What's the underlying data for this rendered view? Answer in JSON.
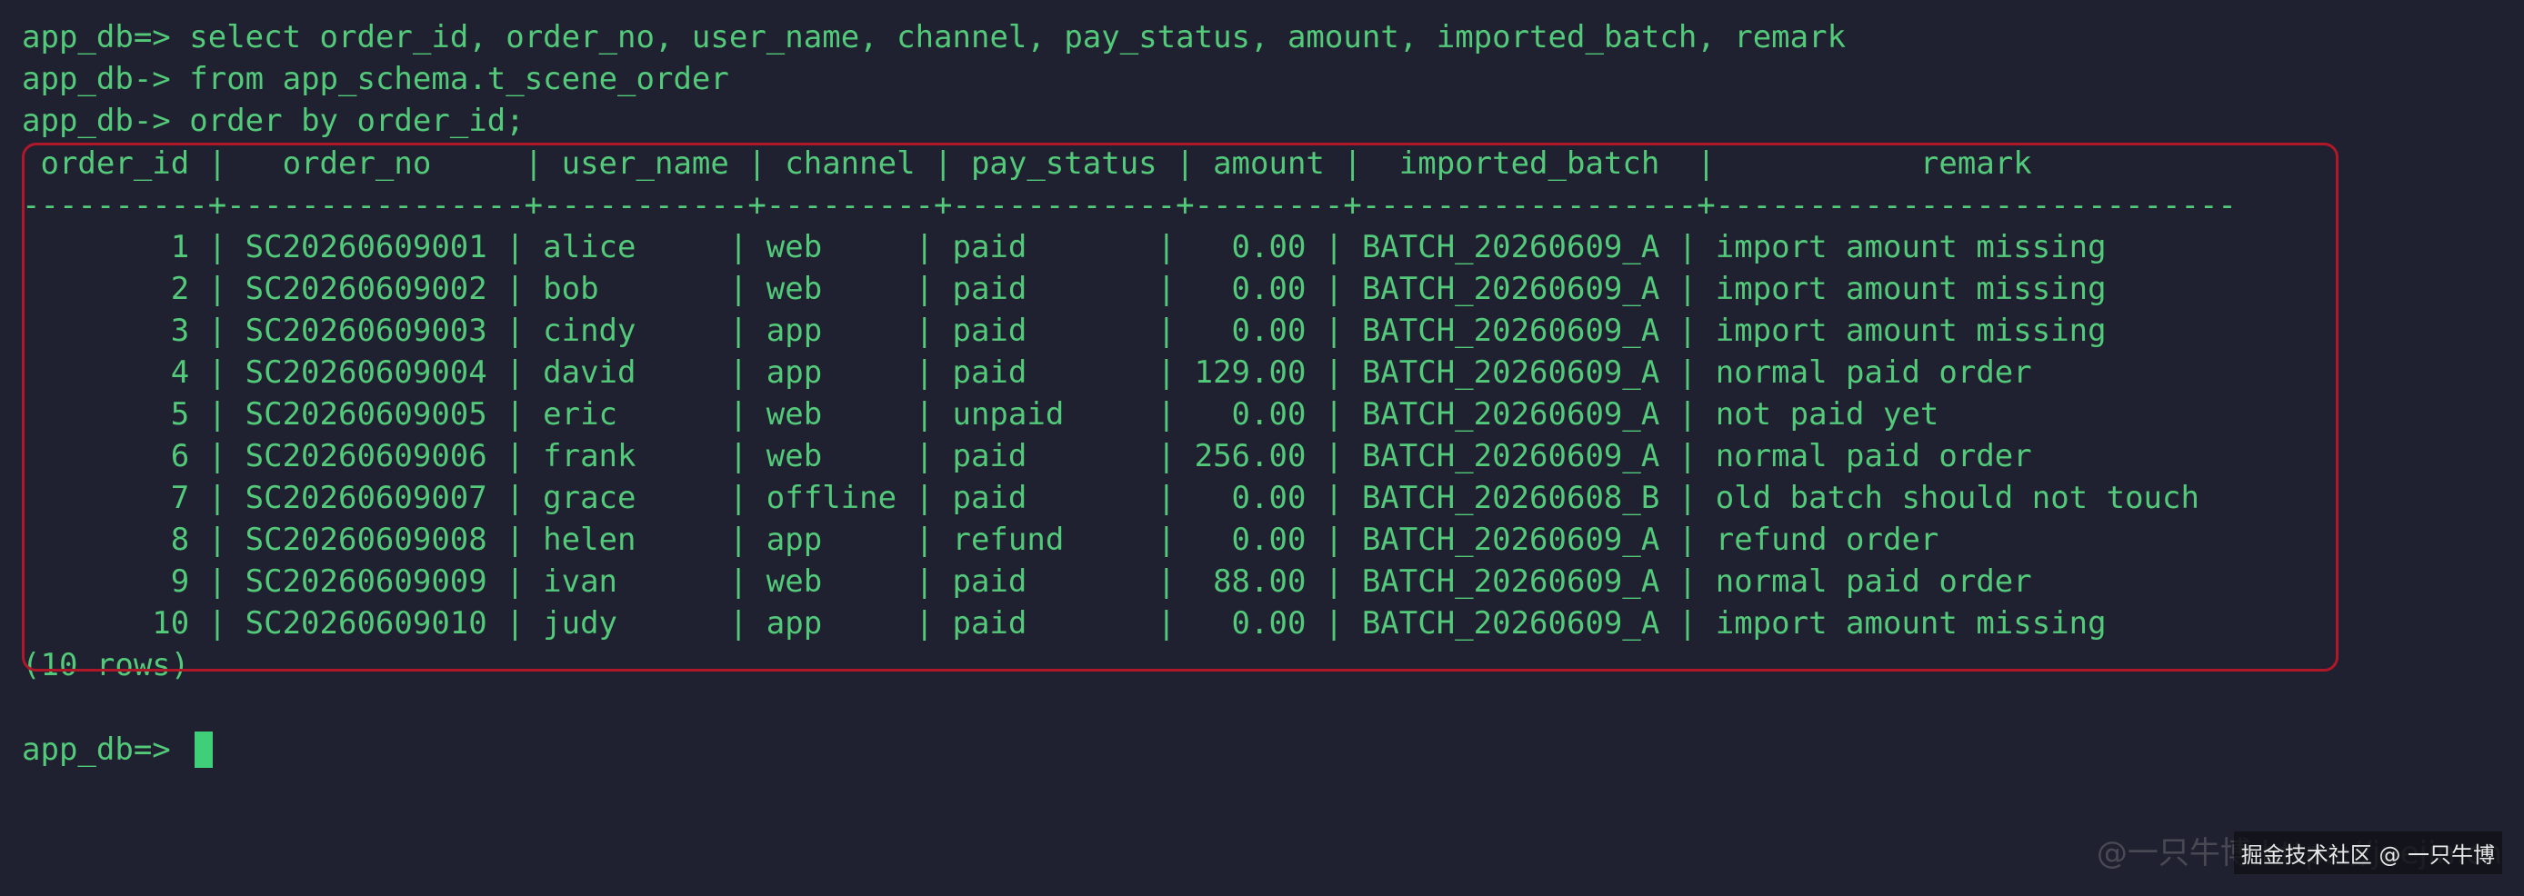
{
  "terminal": {
    "prompt": "app_db=>",
    "cont_prompt": "app_db->",
    "query_lines": [
      "select order_id, order_no, user_name, channel, pay_status, amount, imported_batch, remark",
      "from app_schema.t_scene_order",
      "order by order_id;"
    ],
    "header": " order_id |   order_no     | user_name | channel | pay_status | amount |  imported_batch  |           remark",
    "separator": "----------+----------------+-----------+---------+------------+--------+------------------+----------------------------",
    "rows": [
      "        1 | SC20260609001 | alice     | web     | paid       |   0.00 | BATCH_20260609_A | import amount missing",
      "        2 | SC20260609002 | bob       | web     | paid       |   0.00 | BATCH_20260609_A | import amount missing",
      "        3 | SC20260609003 | cindy     | app     | paid       |   0.00 | BATCH_20260609_A | import amount missing",
      "        4 | SC20260609004 | david     | app     | paid       | 129.00 | BATCH_20260609_A | normal paid order",
      "        5 | SC20260609005 | eric      | web     | unpaid     |   0.00 | BATCH_20260609_A | not paid yet",
      "        6 | SC20260609006 | frank     | web     | paid       | 256.00 | BATCH_20260609_A | normal paid order",
      "        7 | SC20260609007 | grace     | offline | paid       |   0.00 | BATCH_20260608_B | old batch should not touch",
      "        8 | SC20260609008 | helen     | app     | refund     |   0.00 | BATCH_20260609_A | refund order",
      "        9 | SC20260609009 | ivan      | web     | paid       |  88.00 | BATCH_20260609_A | normal paid order",
      "       10 | SC20260609010 | judy      | app     | paid       |   0.00 | BATCH_20260609_A | import amount missing"
    ],
    "footer": "(10 rows)",
    "final_prompt": "app_db=>"
  },
  "watermark": {
    "text": "@一只牛博 https://juejin.cn",
    "badge": "掘金技术社区 @ 一只牛博"
  },
  "colors": {
    "background": "#1f2130",
    "text": "#53c97a",
    "highlight_border": "#b0182a",
    "cursor": "#3fcf78"
  }
}
